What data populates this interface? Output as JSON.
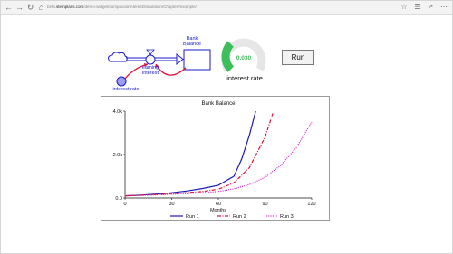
{
  "browser": {
    "url_prefix": "beta.",
    "url_host": "stemplans.com",
    "url_path": "/demo-widget/compound/InterestSimulation/Chapter?example/",
    "icons": {
      "back": "back-arrow-icon",
      "forward": "forward-arrow-icon",
      "refresh": "refresh-icon",
      "home": "home-icon",
      "favorite": "star-icon",
      "menu": "menu-icon"
    }
  },
  "model": {
    "stock_label_line1": "Bank",
    "stock_label_line2": "Balance",
    "flow_label_line1": "earning",
    "flow_label_line2": "interest",
    "converter_label": "interest rate"
  },
  "gauge": {
    "value": "0.030",
    "fraction": 0.33,
    "caption": "interest rate",
    "color": "#3cbf5a"
  },
  "run_button": {
    "label": "Run"
  },
  "chart_data": {
    "type": "line",
    "title": "Bank Balance",
    "xlabel": "Months",
    "ylabel": "",
    "xlim": [
      0,
      120
    ],
    "ylim": [
      0,
      4000
    ],
    "x_ticks": [
      "0",
      "30",
      "60",
      "90",
      "120"
    ],
    "y_ticks": [
      "0.0",
      "2.0k",
      "4.0k"
    ],
    "series": [
      {
        "name": "Run 1",
        "color": "#1a1ab0",
        "style": "solid",
        "x": [
          0,
          10,
          20,
          30,
          40,
          50,
          60,
          70,
          75,
          80,
          84
        ],
        "y": [
          100,
          134,
          181,
          243,
          326,
          438,
          589,
          1000,
          1800,
          2900,
          4000
        ]
      },
      {
        "name": "Run 2",
        "color": "#e0103a",
        "style": "dashdot",
        "x": [
          0,
          10,
          20,
          30,
          40,
          50,
          60,
          70,
          80,
          90,
          95
        ],
        "y": [
          100,
          125,
          156,
          195,
          244,
          305,
          400,
          700,
          1400,
          2800,
          3900
        ]
      },
      {
        "name": "Run 3",
        "color": "#cc1ccc",
        "style": "dotted",
        "x": [
          0,
          20,
          40,
          60,
          70,
          80,
          90,
          100,
          110,
          120
        ],
        "y": [
          100,
          140,
          200,
          300,
          420,
          620,
          950,
          1500,
          2300,
          3500
        ]
      }
    ],
    "legend_position": "bottom"
  }
}
